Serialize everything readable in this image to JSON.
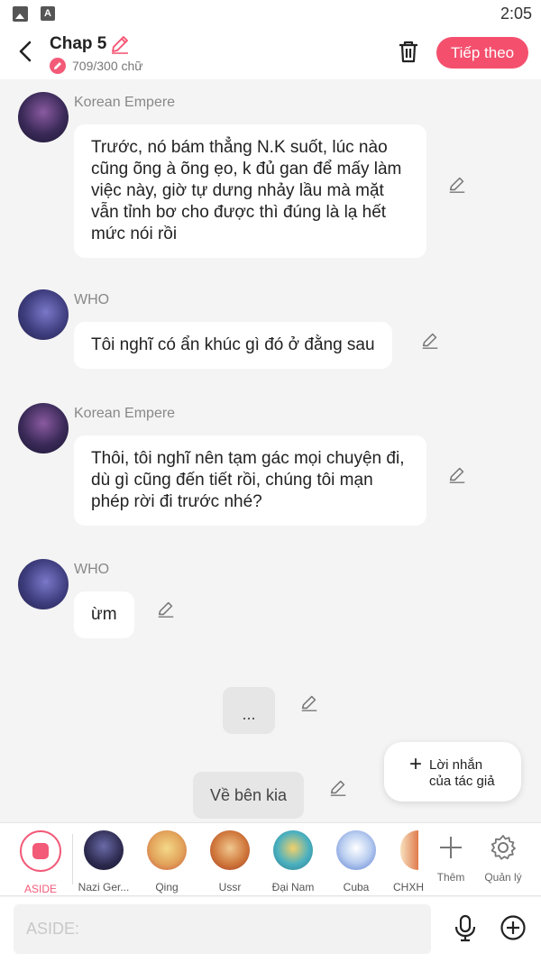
{
  "status_bar": {
    "time": "2:05",
    "icon_left": "image-icon",
    "icon_right_letter": "A"
  },
  "header": {
    "title": "Chap 5",
    "char_count": "709/300 chữ",
    "next_label": "Tiếp theo",
    "accent_color": "#f4506e"
  },
  "messages": [
    {
      "sender": "Korean Empere",
      "text": "Trước, nó bám thẳng N.K suốt, lúc nào cũng õng à õng ẹo, k đủ gan để mấy làm việc này, giờ tự dưng nhảy lầu mà mặt vẫn tỉnh bơ cho được thì đúng là lạ hết mức nói rồi"
    },
    {
      "sender": "WHO",
      "text": "Tôi nghĩ có ẩn khúc gì đó ở đằng sau"
    },
    {
      "sender": "Korean Empere",
      "text": "Thôi, tôi nghĩ nên tạm gác mọi chuyện đi, dù gì cũng đến tiết rồi, chúng tôi mạn phép rời đi trước nhé?"
    },
    {
      "sender": "WHO",
      "text": "ừm"
    }
  ],
  "aside_ellipsis": "...",
  "aside_back": "Về bên kia",
  "author_note": {
    "line1": "Lời nhắn",
    "line2": "của tác giả"
  },
  "characters": [
    {
      "label": "ASIDE",
      "icon": "aside-icon"
    },
    {
      "label": "Nazi Ger..."
    },
    {
      "label": "Qing"
    },
    {
      "label": "Ussr"
    },
    {
      "label": "Đại Nam"
    },
    {
      "label": "Cuba"
    },
    {
      "label": "CHXH"
    }
  ],
  "tools": {
    "add_label": "Thêm",
    "manage_label": "Quản lý"
  },
  "input": {
    "placeholder": "ASIDE:",
    "value": ""
  }
}
